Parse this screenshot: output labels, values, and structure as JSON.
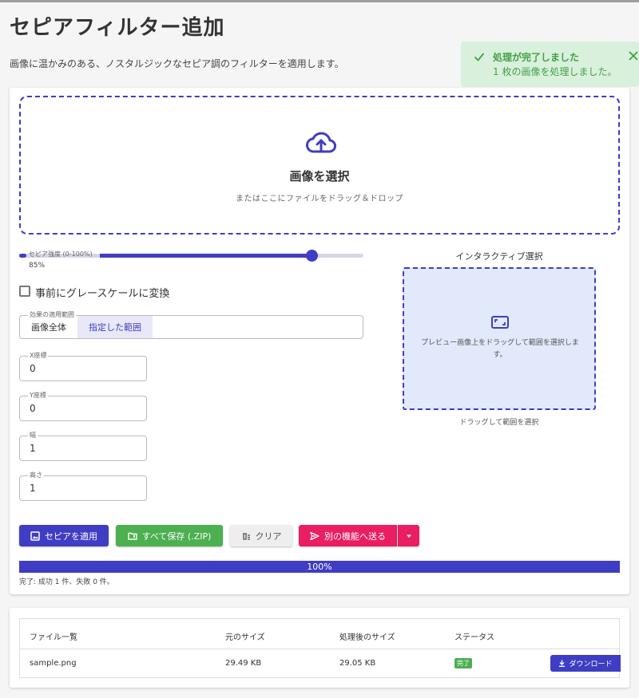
{
  "page": {
    "title": "セピアフィルター追加",
    "subtitle": "画像に温かみのある、ノスタルジックなセピア調のフィルターを適用します。"
  },
  "toast": {
    "title": "処理が完了しました",
    "message": "1 枚の画像を処理しました。",
    "icon": "check-icon",
    "close_icon": "close-icon",
    "color": "#43a047"
  },
  "upload": {
    "title": "画像を選択",
    "hint": "またはここにファイルをドラッグ＆ドロップ",
    "icon": "cloud-upload-icon"
  },
  "slider": {
    "label": "セピア強度 (0-100%)",
    "value_text": "85%",
    "value": 85
  },
  "grayscale": {
    "label": "事前にグレースケールに変換",
    "checked": false
  },
  "scope": {
    "legend": "効果の適用範囲",
    "options": [
      "画像全体",
      "指定した範囲"
    ],
    "selected": "指定した範囲"
  },
  "fields": {
    "x": {
      "label": "X座標",
      "value": "0"
    },
    "y": {
      "label": "Y座標",
      "value": "0"
    },
    "width": {
      "label": "幅",
      "value": "1"
    },
    "height": {
      "label": "高さ",
      "value": "1"
    }
  },
  "interactive": {
    "title": "インタラクティブ選択",
    "hint": "プレビュー画像上をドラッグして範囲を選択します。",
    "caption": "ドラッグして範囲を選択",
    "icon": "crop-free-icon"
  },
  "buttons": {
    "apply": "セピアを適用",
    "save_zip": "すべて保存 (.ZIP)",
    "clear": "クリア",
    "send": "別の機能へ送る"
  },
  "progress": {
    "percent": 100,
    "label": "100%",
    "summary": "完了: 成功 1 件、失敗 0 件。"
  },
  "table": {
    "headers": [
      "ファイル一覧",
      "元のサイズ",
      "処理後のサイズ",
      "ステータス"
    ],
    "rows": [
      {
        "name": "sample.png",
        "original_size": "29.49 KB",
        "processed_size": "29.05 KB",
        "status": "完了",
        "action": "ダウンロード"
      }
    ]
  },
  "colors": {
    "primary": "#3f3dc4",
    "success": "#4caf50",
    "accent": "#e91e63",
    "toast_bg": "#d9f0dc"
  }
}
